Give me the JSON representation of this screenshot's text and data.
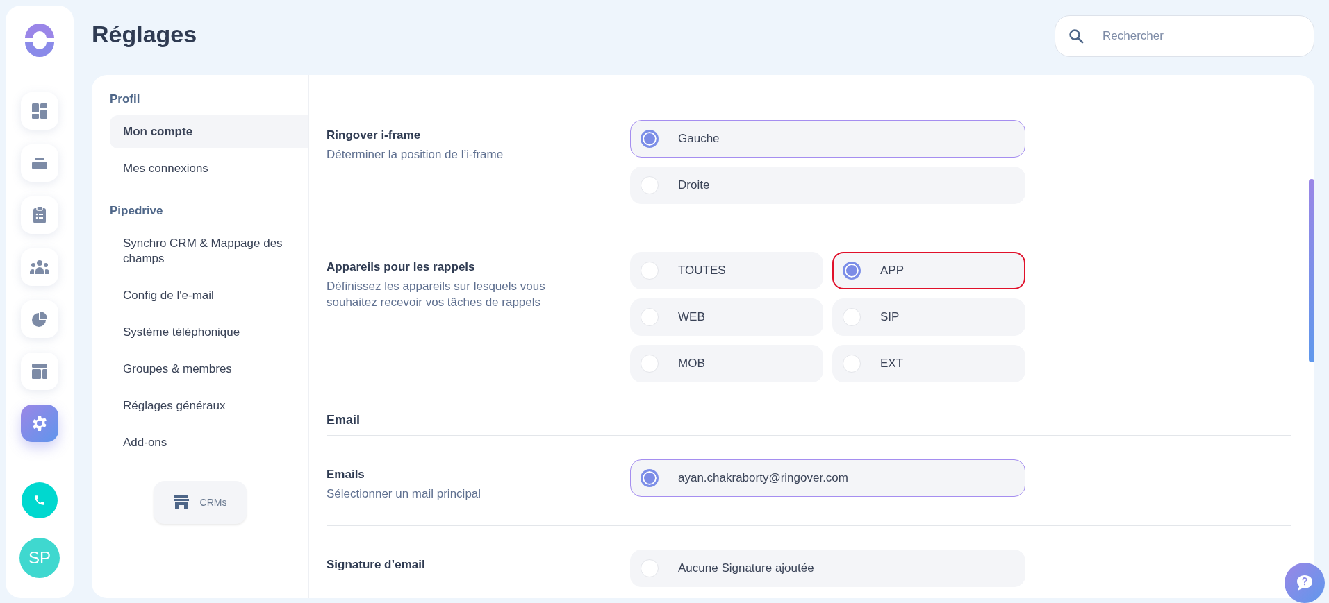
{
  "app_rail": {
    "items": [
      {
        "kind": "dashboard",
        "selected": false
      },
      {
        "kind": "tray",
        "selected": false
      },
      {
        "kind": "clipboard",
        "selected": false
      },
      {
        "kind": "team",
        "selected": false
      },
      {
        "kind": "pie",
        "selected": false
      },
      {
        "kind": "layout",
        "selected": false
      },
      {
        "kind": "settings",
        "selected": true
      }
    ],
    "avatar": {
      "initials": "SP"
    }
  },
  "page_title": "Réglages",
  "search": {
    "placeholder": "Rechercher"
  },
  "settings_nav": {
    "sections": [
      {
        "title": "Profil",
        "items": [
          {
            "label": "Mon compte",
            "selected": true
          },
          {
            "label": "Mes connexions",
            "selected": false
          }
        ]
      },
      {
        "title": "Pipedrive",
        "items": [
          {
            "label": "Synchro CRM & Mappage des champs",
            "selected": false
          },
          {
            "label": "Config de l'e-mail",
            "selected": false
          },
          {
            "label": "Système téléphonique",
            "selected": false
          },
          {
            "label": "Groupes & membres",
            "selected": false
          },
          {
            "label": "Réglages généraux",
            "selected": false
          },
          {
            "label": "Add-ons",
            "selected": false
          }
        ]
      }
    ],
    "crms_button": {
      "label": "CRMs"
    }
  },
  "content": {
    "items": [
      {
        "kind": "setting-list",
        "title": "Ringover i-frame",
        "description": "Déterminer la position de l’i-frame",
        "options": [
          {
            "label": "Gauche",
            "selected": true,
            "focused": false
          },
          {
            "label": "Droite",
            "selected": false,
            "focused": false
          }
        ]
      },
      {
        "kind": "setting-grid",
        "title": "Appareils pour les rappels",
        "description": "Définissez les appareils sur lesquels vous souhaitez recevoir vos tâches de rappels",
        "options": [
          {
            "label": "TOUTES",
            "selected": false,
            "focused": false
          },
          {
            "label": "APP",
            "selected": true,
            "focused": true
          },
          {
            "label": "WEB",
            "selected": false,
            "focused": false
          },
          {
            "label": "SIP",
            "selected": false,
            "focused": false
          },
          {
            "label": "MOB",
            "selected": false,
            "focused": false
          },
          {
            "label": "EXT",
            "selected": false,
            "focused": false
          }
        ]
      },
      {
        "kind": "heading",
        "title": "Email"
      },
      {
        "kind": "setting-list",
        "title": "Emails",
        "description": "Sélectionner un mail principal",
        "options": [
          {
            "label": "ayan.chakraborty@ringover.com",
            "selected": true,
            "focused": false
          }
        ]
      },
      {
        "kind": "setting-list",
        "title": "Signature d’email",
        "options": [
          {
            "label": "Aucune Signature ajoutée",
            "selected": false,
            "focused": false
          }
        ]
      }
    ]
  }
}
